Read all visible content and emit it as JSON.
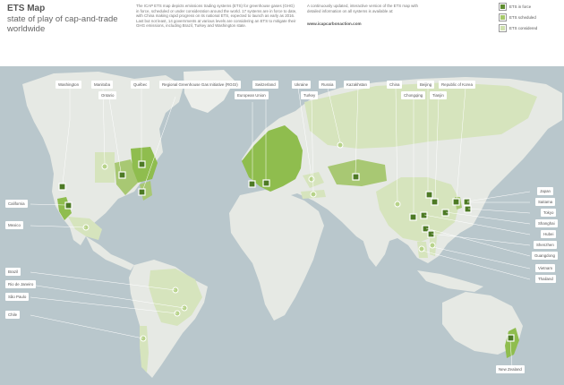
{
  "header": {
    "title": "ETS Map",
    "subtitle": "state of play of cap-and-trade worldwide",
    "description": "The ICAP ETS map depicts emissions trading systems (ETS) for greenhouse gases (GHG) in force, scheduled or under consideration around the world. 17 systems are in force to date, with China making rapid progress on its national ETS, expected to launch as early as 2016. Last but not least, 14 governments at various levels are considering an ETS to mitigate their GHG emissions, including Brazil, Turkey and Washington state.",
    "update_note": "A continuously updated, interactive version of the ETS map with detailed information on all systems is available at:",
    "url": "www.icapcarbonaction.com"
  },
  "legend": {
    "items": [
      {
        "label": "ETS in force",
        "color": "#5e8c2f"
      },
      {
        "label": "ETS scheduled",
        "color": "#a6c86a"
      },
      {
        "label": "ETS considered",
        "color": "#cfe0ae"
      }
    ]
  },
  "colors": {
    "ocean": "#b9c7cc",
    "land": "#e8ebe6",
    "in_force": "#8fbd4e",
    "scheduled": "#b7d389",
    "considered": "#d6e4bd",
    "marker": "#4d7a25"
  },
  "labels": {
    "washington": "Washington",
    "manitoba": "Manitoba",
    "ontario": "Ontario",
    "quebec": "Québec",
    "rggi": "Regional Greenhouse Gas Initiative (RGGI)",
    "switzerland": "Switzerland",
    "eu": "European Union",
    "ukraine": "Ukraine",
    "russia": "Russia",
    "kazakhstan": "Kazakhstan",
    "turkey": "Turkey",
    "china": "China",
    "beijing": "Beijing",
    "korea": "Republic of Korea",
    "chongqing": "Chongqing",
    "tianjin": "Tianjin",
    "california": "California",
    "mexico": "Mexico",
    "japan": "Japan",
    "saitama": "Saitama",
    "tokyo": "Tokyo",
    "shanghai": "Shanghai",
    "hubei": "Hubei",
    "shenzhen": "Shenzhen",
    "guangdong": "Guangdong",
    "vietnam": "Vietnam",
    "thailand": "Thailand",
    "brazil": "Brazil",
    "rio": "Rio de Janeiro",
    "saopaulo": "São Paulo",
    "chile": "Chile",
    "newzealand": "New Zealand"
  }
}
